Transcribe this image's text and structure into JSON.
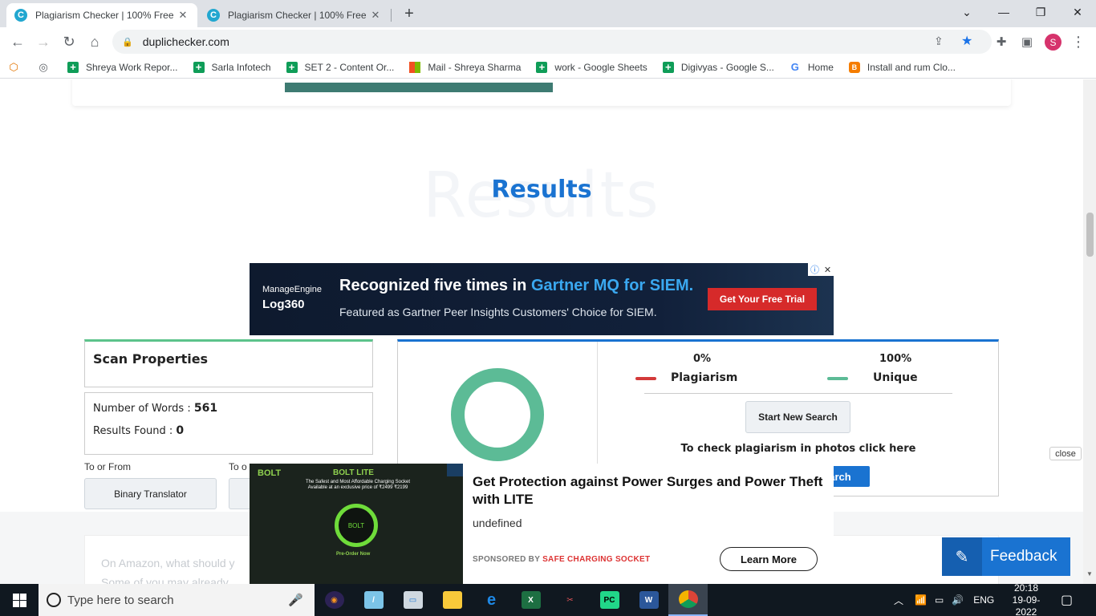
{
  "browser": {
    "tabs": [
      {
        "title": "Plagiarism Checker | 100% Free a",
        "favicon": "C"
      },
      {
        "title": "Plagiarism Checker | 100% Free a",
        "favicon": "C"
      }
    ],
    "url": "duplichecker.com",
    "profile_initial": "S",
    "bookmarks": [
      {
        "label": "Shreya Work Repor...",
        "icon": "sheets-icon"
      },
      {
        "label": "Sarla Infotech",
        "icon": "sheets-icon"
      },
      {
        "label": "SET 2 - Content Or...",
        "icon": "sheets-icon"
      },
      {
        "label": "Mail - Shreya Sharma",
        "icon": "microsoft-icon"
      },
      {
        "label": "work - Google Sheets",
        "icon": "sheets-icon"
      },
      {
        "label": "Digivyas - Google S...",
        "icon": "sheets-icon"
      },
      {
        "label": "Home",
        "icon": "google-icon"
      },
      {
        "label": "Install and rum Clo...",
        "icon": "blogger-icon"
      }
    ]
  },
  "page": {
    "results_bg_word": "Results",
    "results_title": "Results",
    "ad_banner": {
      "brand_top": "ManageEngine",
      "brand_bottom": "Log360",
      "headline_a": "Recognized five times in ",
      "headline_b": "Gartner MQ for SIEM.",
      "subline": "Featured as Gartner Peer Insights Customers' Choice for SIEM.",
      "cta": "Get Your Free Trial"
    },
    "scan_properties": {
      "title": "Scan Properties",
      "words_label": "Number of Words : ",
      "words_value": "561",
      "results_label": "Results Found : ",
      "results_value": "0"
    },
    "to_or_from": "To or From",
    "to_or_2": "To o",
    "tool_button": "Binary Translator",
    "result": {
      "plagiarism_pct": "0%",
      "unique_pct": "100%",
      "plagiarism_label": "Plagiarism",
      "unique_label": "Unique",
      "plagiarism_color": "#d33a3a",
      "unique_color": "#5cbb96",
      "unique_fraction": 1.0,
      "new_search": "Start New Search",
      "photo_link": "To check plagiarism in photos click here",
      "search_btn_partial": "earch"
    },
    "article_line1": "On Amazon, what should y",
    "article_line2": "Some of you may already",
    "close_label": "close",
    "feedback_label": "Feedback"
  },
  "bottom_ad": {
    "bolt_logo": "BOLT",
    "bolt_lite": "BOLT LITE",
    "image_tagline": "The Safest and Most Affordable Charging Socket",
    "image_price": "Available at an exclusive price of ₹2499 ₹2199",
    "preorder": "Pre-Order Now",
    "headline": "Get Protection against Power Surges and Power Theft with LITE",
    "description": "undefined",
    "sponsored_by": "SPONSORED BY ",
    "sponsor": "SAFE CHARGING SOCKET",
    "cta": "Learn More"
  },
  "taskbar": {
    "search_placeholder": "Type here to search",
    "language": "ENG",
    "time": "20:18",
    "date": "19-09-2022"
  }
}
